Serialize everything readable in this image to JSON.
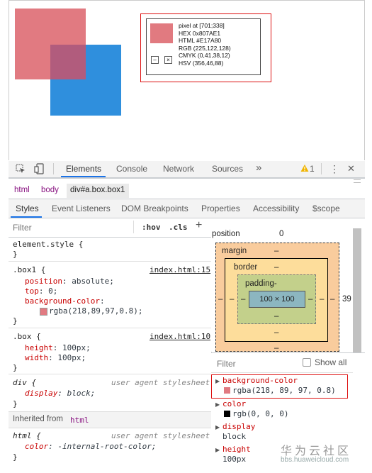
{
  "picker": {
    "pixel": "pixel at [701;338]",
    "hex": "HEX 0x807AE1",
    "html": "HTML #E17A80",
    "rgb": "RGB (225,122,128)",
    "cmyk": "CMYK (0,41,38,12)",
    "hsv": "HSV (356,46,88)",
    "btn_minus": "–",
    "btn_x": "×"
  },
  "toolbar": {
    "tabs": [
      "Elements",
      "Console",
      "Network",
      "Sources"
    ],
    "more": "»",
    "warning_count": "1",
    "menu": "⋮",
    "close": "✕"
  },
  "breadcrumb": [
    "html",
    "body",
    "div#a.box.box1"
  ],
  "subtabs": [
    "Styles",
    "Event Listeners",
    "DOM Breakpoints",
    "Properties",
    "Accessibility",
    "$scope"
  ],
  "styles": {
    "filter_placeholder": "Filter",
    "hov": ":hov",
    "cls": ".cls",
    "plus": "+",
    "element_style": "element.style {",
    "close_brace": "}",
    "rule1": {
      "selector": ".box1 {",
      "source": "index.html:15",
      "p1": "position",
      "v1": ": absolute;",
      "p2": "top",
      "v2": ": 0;",
      "p3": "background-color",
      "v3": ":",
      "v3b": "rgba(218,89,97,0.8);"
    },
    "rule2": {
      "selector": ".box {",
      "source": "index.html:10",
      "p1": "height",
      "v1": ": 100px;",
      "p2": "width",
      "v2": ": 100px;"
    },
    "rule3": {
      "selector": "div {",
      "source": "user agent stylesheet",
      "p1": "display",
      "v1": ": block;"
    },
    "inherited_label": "Inherited from",
    "inherited_from": "html",
    "rule4": {
      "selector": "html {",
      "source": "user agent stylesheet",
      "p1": "color",
      "v1": ": -internal-root-color;"
    }
  },
  "boxmodel": {
    "position_label": "position",
    "position_value": "0",
    "margin_label": "margin",
    "border_label": "border",
    "padding_label": "padding-",
    "content": "100 × 100",
    "dash": "–",
    "right_value": "39"
  },
  "computed": {
    "filter_placeholder": "Filter",
    "show_all": "Show all",
    "items": [
      {
        "name": "background-color",
        "value": "rgba(218, 89, 97, 0.8)"
      },
      {
        "name": "color",
        "value": "rgb(0, 0, 0)"
      },
      {
        "name": "display",
        "value": "block"
      },
      {
        "name": "height",
        "value": "100px"
      }
    ]
  },
  "watermark": {
    "cn": "华为云社区",
    "url": "bbs.huaweicloud.com"
  },
  "colors": {
    "accent": "#1a73e8",
    "pink": "#da5961",
    "blue": "#2f8fdd",
    "picker_swatch": "#e17a80"
  }
}
